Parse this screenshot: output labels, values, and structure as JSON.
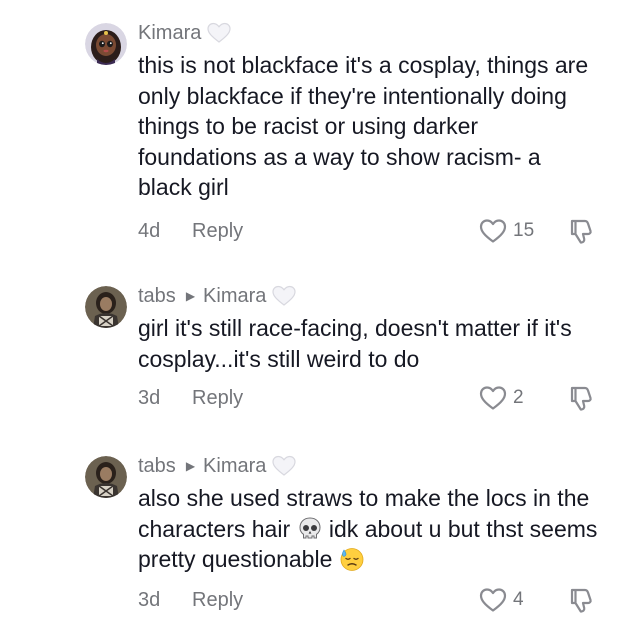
{
  "comments": [
    {
      "username": "Kimara",
      "reply_to": "",
      "text": "this is not blackface it's a cosplay, things are only blackface if they're intentionally doing things to be racist or using darker foundations as a way to show racism- a black girl",
      "age": "4d",
      "reply_label": "Reply",
      "likes": "15",
      "avatar_icon": "doll-avatar",
      "badge_icon": "white-heart-emoji"
    },
    {
      "username": "tabs",
      "reply_to": "Kimara",
      "text": "girl it's still race-facing, doesn't matter if it's cosplay...it's still weird to do",
      "age": "3d",
      "reply_label": "Reply",
      "likes": "2",
      "avatar_icon": "photo-avatar",
      "badge_icon": "white-heart-emoji"
    },
    {
      "username": "tabs",
      "reply_to": "Kimara",
      "text_part1": "also she used straws to make the locs in the characters hair ",
      "text_part2": " idk about u but thst seems pretty questionable ",
      "emoji1": "skull-emoji",
      "emoji2": "downcast-sweat-emoji",
      "age": "3d",
      "reply_label": "Reply",
      "likes": "4",
      "avatar_icon": "photo-avatar",
      "badge_icon": "white-heart-emoji"
    }
  ],
  "colors": {
    "text": "#161823",
    "muted": "#73757a",
    "icon": "#8a8b91"
  }
}
